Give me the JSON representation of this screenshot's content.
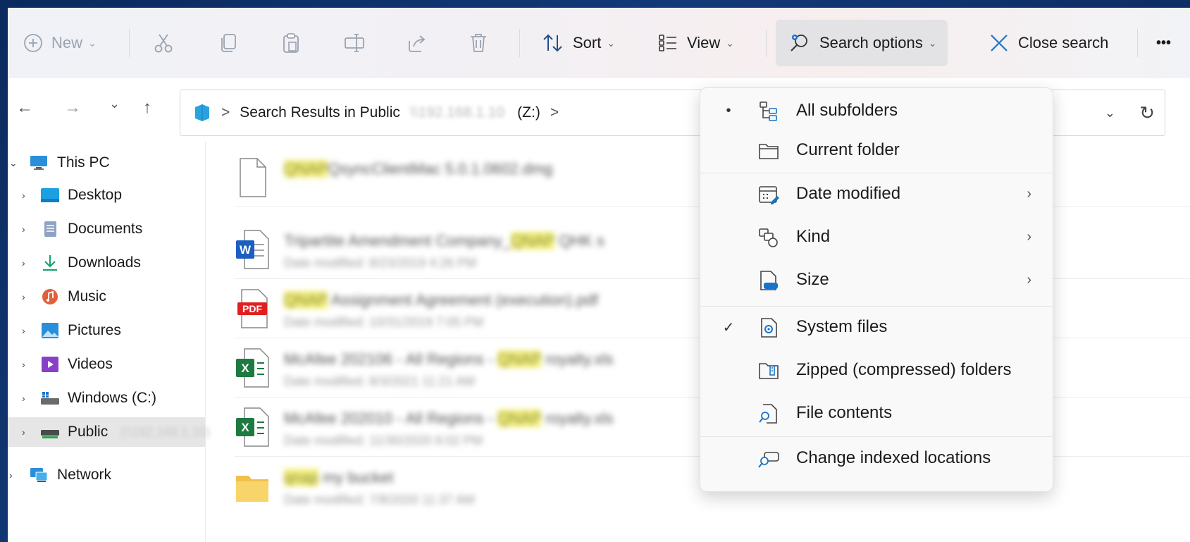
{
  "toolbar": {
    "new_label": "New",
    "sort_label": "Sort",
    "view_label": "View",
    "search_options_label": "Search options",
    "close_search_label": "Close search",
    "more_label": "•••",
    "cut_icon": "cut-icon",
    "copy_icon": "copy-icon",
    "paste_icon": "paste-icon",
    "rename_icon": "rename-icon",
    "share_icon": "share-icon",
    "delete_icon": "delete-icon"
  },
  "nav": {
    "back": "←",
    "forward": "→",
    "recent": "⌄",
    "up": "↑"
  },
  "address": {
    "separator": ">",
    "location": "Search Results in Public",
    "drive": "(Z:)",
    "refresh": "↻"
  },
  "sidebar": {
    "items": [
      {
        "label": "This PC",
        "expanded": true
      },
      {
        "label": "Desktop"
      },
      {
        "label": "Documents"
      },
      {
        "label": "Downloads"
      },
      {
        "label": "Music"
      },
      {
        "label": "Pictures"
      },
      {
        "label": "Videos"
      },
      {
        "label": "Windows (C:)"
      },
      {
        "label": "Public",
        "selected": true
      },
      {
        "label": "Network"
      }
    ]
  },
  "results": [
    {
      "type": "file",
      "name_prefix": "QNAP",
      "name_rest": "QsyncClientMac 5.0.1.0602.dmg",
      "meta": ""
    },
    {
      "type": "word",
      "name_prefix": "Tripartite Amendment Company_",
      "name_hl": "QNAP",
      "name_rest": " QHK s",
      "meta": "Date modified: 8/23/2019 4:26 PM"
    },
    {
      "type": "pdf",
      "name_prefix": "QNAP",
      "name_rest": " Assignment Agreement (execution).pdf",
      "meta": "Date modified: 10/31/2019 7:05 PM"
    },
    {
      "type": "excel",
      "name_prefix": "McAfee 202106 - All Regions - ",
      "name_hl": "QNAP",
      "name_rest": " royalty.xls",
      "meta": "Date modified: 8/3/2021 11:21 AM"
    },
    {
      "type": "excel",
      "name_prefix": "McAfee 202010 - All Regions - ",
      "name_hl": "QNAP",
      "name_rest": " royalty.xls",
      "meta": "Date modified: 11/30/2020 6:02 PM"
    },
    {
      "type": "folder",
      "name_prefix": "qnap",
      "name_rest": " my bucket",
      "meta": "Date modified: 7/8/2020 11:37 AM"
    }
  ],
  "search_menu": {
    "items": [
      {
        "label": "All subfolders",
        "mark": "•",
        "icon": "subfolders-icon"
      },
      {
        "label": "Current folder",
        "mark": "",
        "icon": "folder-icon"
      },
      {
        "label": "Date modified",
        "mark": "",
        "icon": "calendar-icon",
        "submenu": "›"
      },
      {
        "label": "Kind",
        "mark": "",
        "icon": "kind-icon",
        "submenu": "›"
      },
      {
        "label": "Size",
        "mark": "",
        "icon": "size-icon",
        "submenu": "›"
      },
      {
        "label": "System files",
        "mark": "✓",
        "icon": "system-file-icon"
      },
      {
        "label": "Zipped (compressed) folders",
        "mark": "",
        "icon": "zip-folder-icon"
      },
      {
        "label": "File contents",
        "mark": "",
        "icon": "file-search-icon"
      },
      {
        "label": "Change indexed locations",
        "mark": "",
        "icon": "index-locations-icon"
      }
    ]
  },
  "colors": {
    "accent": "#1a73c8",
    "highlight": "#f3f07a",
    "selected_bg": "#e6e6e6"
  }
}
